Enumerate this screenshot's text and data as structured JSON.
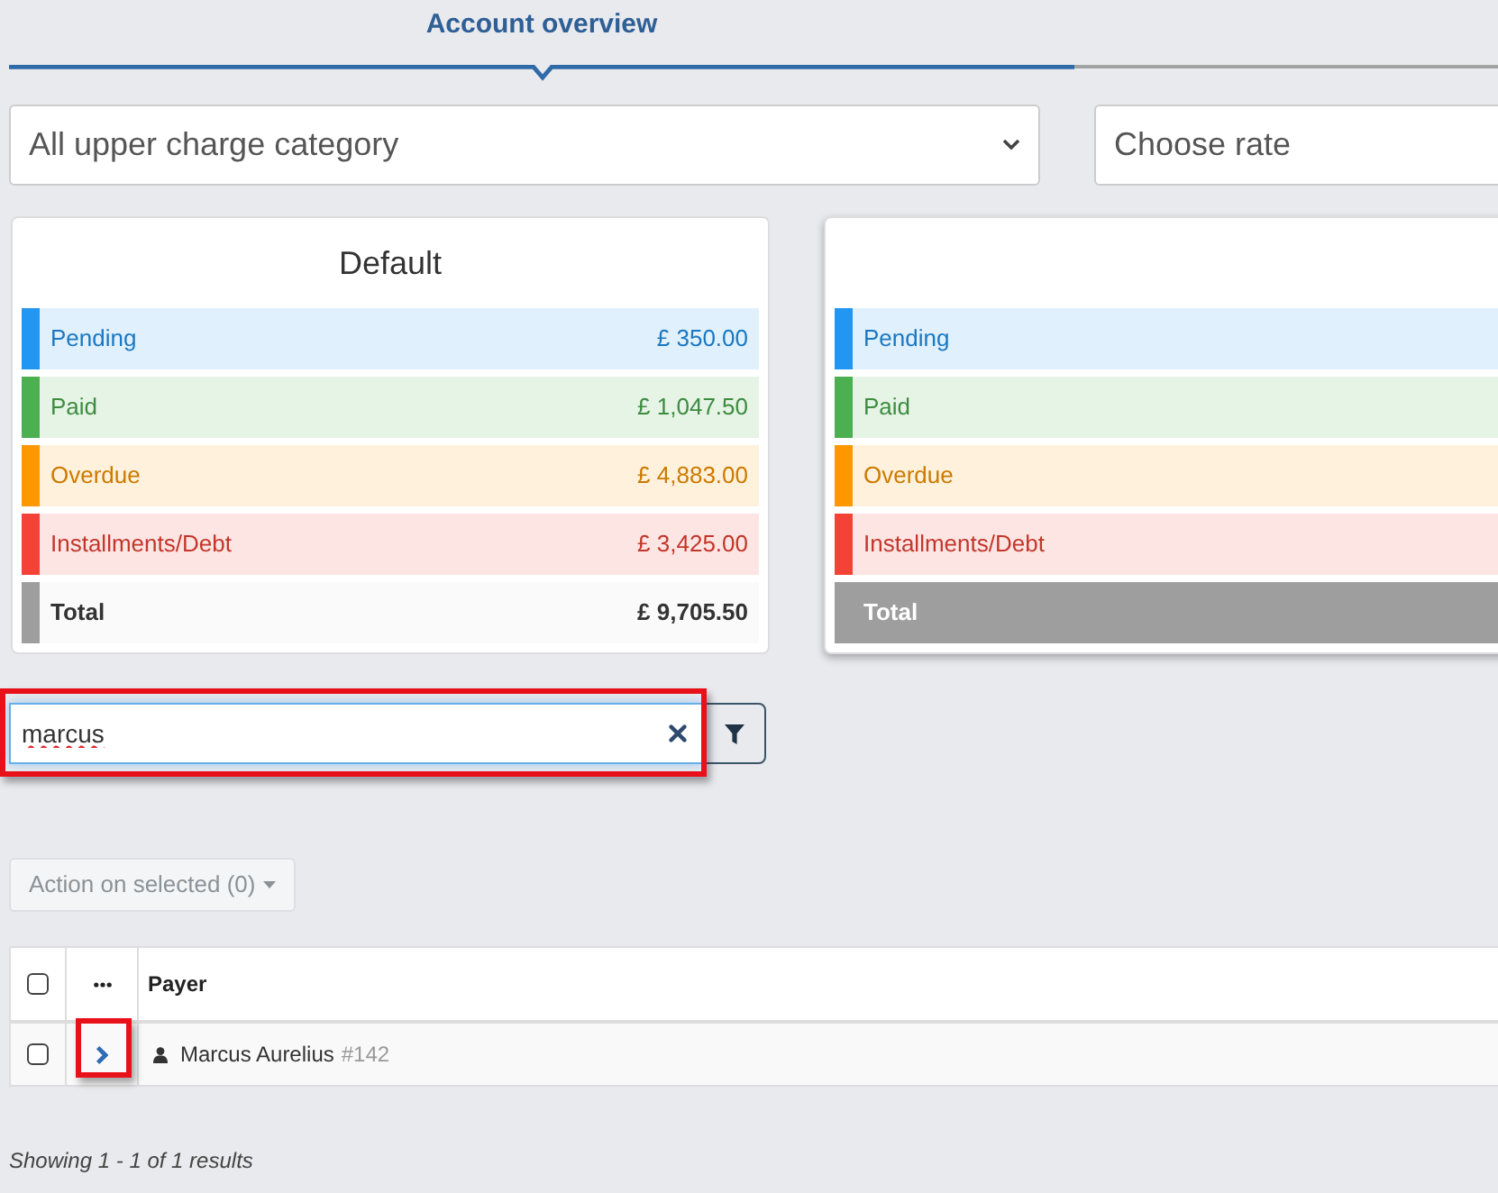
{
  "tabs": [
    {
      "label": "Account overview",
      "selected": true
    }
  ],
  "filters": [
    {
      "value": "All upper charge category",
      "caret": true
    },
    {
      "value": "Choose rate",
      "caret": false
    }
  ],
  "cards": [
    {
      "title": "Default",
      "selected": false,
      "rows": [
        {
          "kind": "status",
          "label": "Pending",
          "amount": "£ 350.00",
          "color": "#2196f3"
        },
        {
          "kind": "status",
          "label": "Paid",
          "amount": "£ 1,047.50",
          "color": "#4caf50"
        },
        {
          "kind": "status",
          "label": "Overdue",
          "amount": "£ 4,883.00",
          "color": "#ff9800"
        },
        {
          "kind": "status",
          "label": "Installments/Debt",
          "amount": "£ 3,425.00",
          "color": "#f44336"
        },
        {
          "kind": "total",
          "label": "Total",
          "amount": "£ 9,705.50",
          "color": "#9e9e9e"
        }
      ]
    },
    {
      "selected": true,
      "rows": [
        {
          "kind": "status",
          "label": "Pending",
          "color": "#2196f3"
        },
        {
          "kind": "status",
          "label": "Paid",
          "color": "#4caf50"
        },
        {
          "kind": "status",
          "label": "Overdue",
          "color": "#ff9800"
        },
        {
          "kind": "status",
          "label": "Installments/Debt",
          "color": "#f44336"
        },
        {
          "kind": "total",
          "label": "Total",
          "color": "#9e9e9e"
        }
      ]
    }
  ],
  "search": {
    "value": "marcus",
    "highlighted": true
  },
  "action_button": {
    "label": "Action on selected (0)",
    "disabled": true
  },
  "table": {
    "columns": [
      {
        "kind": "checkbox",
        "checked": false
      },
      {
        "kind": "more"
      },
      {
        "kind": "text",
        "label": "Payer"
      }
    ],
    "rows": [
      {
        "checked": false,
        "highlighted": true,
        "payer": "Marcus Aurelius",
        "id": "#142"
      }
    ]
  },
  "footer": "Showing 1 - 1 of 1 results"
}
